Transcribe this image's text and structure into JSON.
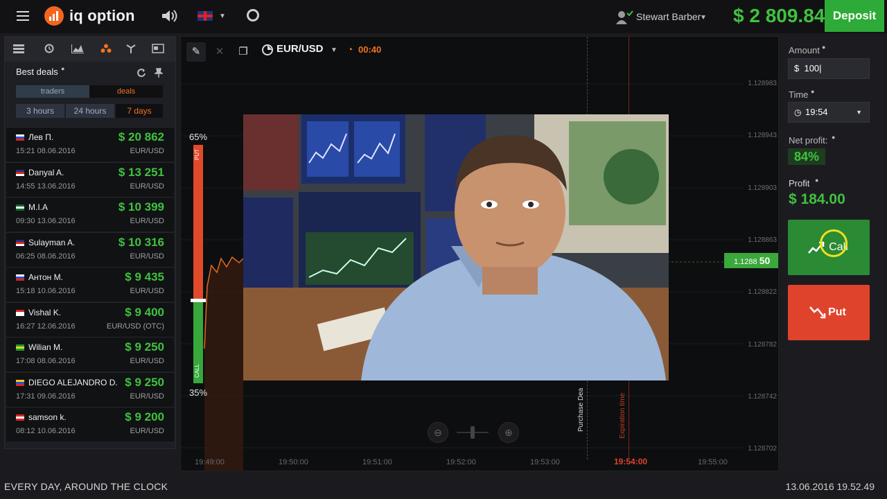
{
  "app": {
    "logo_text": "iq option"
  },
  "header": {
    "user_name": "Stewart Barber",
    "balance": "$ 2 809.84",
    "deposit_label": "Deposit"
  },
  "left_panel": {
    "title": "Best deals",
    "tabs": [
      "traders",
      "deals"
    ],
    "active_tab": "deals",
    "periods": [
      "3 hours",
      "24 hours",
      "7 days"
    ],
    "active_period": "7 days",
    "deals": [
      {
        "name": "Лев П.",
        "time": "15:21 08.06.2016",
        "amount": "$ 20 862",
        "pair": "EUR/USD",
        "flag": "ru"
      },
      {
        "name": "Danyal A.",
        "time": "14:55 13.06.2016",
        "amount": "$ 13 251",
        "pair": "EUR/USD",
        "flag": "uk"
      },
      {
        "name": "M.I.A",
        "time": "09:30 13.06.2016",
        "amount": "$ 10 399",
        "pair": "EUR/USD",
        "flag": "pk"
      },
      {
        "name": "Sulayman A.",
        "time": "06:25 08.06.2016",
        "amount": "$ 10 316",
        "pair": "EUR/USD",
        "flag": "uk"
      },
      {
        "name": "Антон М.",
        "time": "15:18 10.06.2016",
        "amount": "$ 9 435",
        "pair": "EUR/USD",
        "flag": "ru"
      },
      {
        "name": "Vishal K.",
        "time": "16:27 12.06.2016",
        "amount": "$ 9 400",
        "pair": "EUR/USD (OTC)",
        "flag": "id"
      },
      {
        "name": "Wilian M.",
        "time": "17:08 08.06.2016",
        "amount": "$ 9 250",
        "pair": "EUR/USD",
        "flag": "br"
      },
      {
        "name": "DIEGO ALEJANDRO D.",
        "time": "17:31 09.06.2016",
        "amount": "$ 9 250",
        "pair": "EUR/USD",
        "flag": "co"
      },
      {
        "name": "samson k.",
        "time": "08:12 10.06.2016",
        "amount": "$ 9 200",
        "pair": "EUR/USD",
        "flag": "ca"
      }
    ]
  },
  "chart": {
    "pair": "EUR/USD",
    "timer": "00:40",
    "put_pct": "65%",
    "call_pct": "35%",
    "put_label": "PUT",
    "call_label": "CALL",
    "price_ticks": [
      "1.128983",
      "1.128943",
      "1.128903",
      "1.128863",
      "1.128822",
      "1.128782",
      "1.128742",
      "1.128702"
    ],
    "time_ticks": [
      "19:49:00",
      "19:50:00",
      "19:51:00",
      "19:52:00",
      "19:53:00",
      "19:54:00",
      "19:55:00"
    ],
    "current_price_small": "1.1288",
    "current_price_big": "50",
    "purchase_label": "Purchase Dea",
    "expiration_label": "Expiration time"
  },
  "right_panel": {
    "amount_label": "Amount",
    "amount_value": "100",
    "currency": "$",
    "time_label": "Time",
    "time_value": "19:54",
    "net_profit_label": "Net profit:",
    "net_profit_value": "84%",
    "profit_label": "Profit",
    "profit_value": "$ 184.00",
    "call_label": "Call",
    "put_label": "Put"
  },
  "footer": {
    "tagline": "EVERY DAY, AROUND THE CLOCK",
    "datetime": "13.06.2016 19.52.49"
  }
}
